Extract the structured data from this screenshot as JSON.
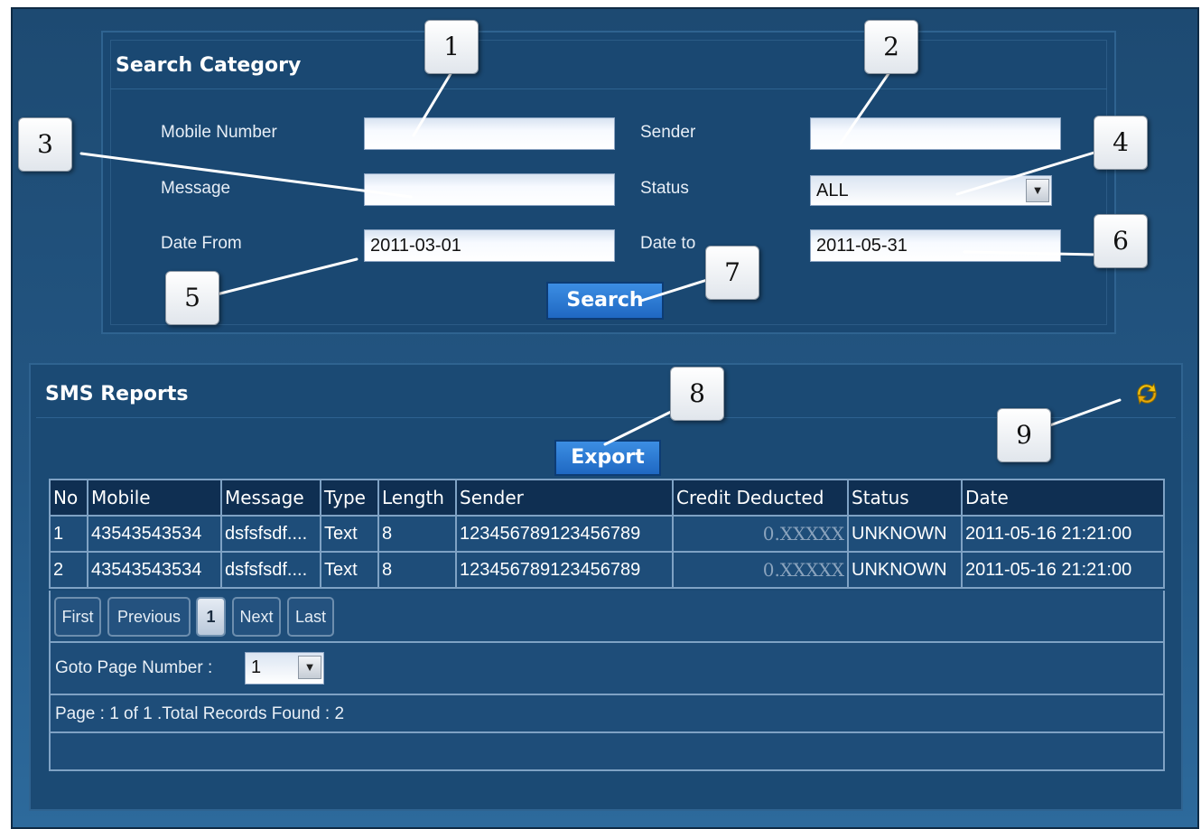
{
  "search": {
    "title": "Search Category",
    "labels": {
      "mobile": "Mobile Number",
      "sender": "Sender",
      "message": "Message",
      "status": "Status",
      "date_from": "Date From",
      "date_to": "Date to"
    },
    "values": {
      "mobile": "",
      "sender": "",
      "message": "",
      "status": "ALL",
      "date_from": "2011-03-01",
      "date_to": "2011-05-31"
    },
    "search_button": "Search"
  },
  "reports": {
    "title": "SMS Reports",
    "export_button": "Export",
    "refresh_icon": "refresh-icon",
    "columns": [
      "No",
      "Mobile",
      "Message",
      "Type",
      "Length",
      "Sender",
      "Credit Deducted",
      "Status",
      "Date"
    ],
    "rows": [
      [
        "1",
        "43543543534",
        "dsfsfsdf....",
        "Text",
        "8",
        "123456789123456789",
        "0.XXXXX",
        "UNKNOWN",
        "2011-05-16 21:21:00"
      ],
      [
        "2",
        "43543543534",
        "dsfsfsdf....",
        "Text",
        "8",
        "123456789123456789",
        "0.XXXXX",
        "UNKNOWN",
        "2011-05-16 21:21:00"
      ]
    ],
    "pagination": {
      "first": "First",
      "previous": "Previous",
      "current": "1",
      "next": "Next",
      "last": "Last"
    },
    "goto_label": "Goto Page Number :",
    "goto_value": "1",
    "page_info": "Page : 1 of 1 .Total Records Found : 2"
  },
  "callouts": [
    "1",
    "2",
    "3",
    "4",
    "5",
    "6",
    "7",
    "8",
    "9"
  ],
  "colors": {
    "background": "#1d4a72",
    "panel": "#1a4872",
    "button": "#2a78d4",
    "table_header": "#0f2f52",
    "grid_line": "#7fa2c4"
  }
}
